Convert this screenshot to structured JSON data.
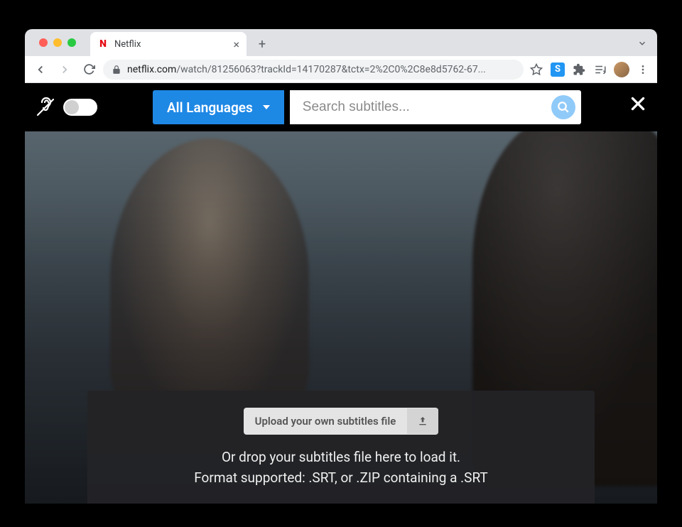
{
  "browser": {
    "tab": {
      "favicon_letter": "N",
      "title": "Netflix"
    },
    "url": {
      "domain": "netflix.com",
      "path": "/watch/81256063?trackId=14170287&tctx=2%2C0%2C8e8d5762-67..."
    }
  },
  "overlay": {
    "language_label": "All Languages",
    "search_placeholder": "Search subtitles..."
  },
  "upload": {
    "button_label": "Upload your own subtitles file",
    "line1": "Or drop your subtitles file here to load it.",
    "line2": "Format supported: .SRT, or .ZIP containing a .SRT"
  }
}
